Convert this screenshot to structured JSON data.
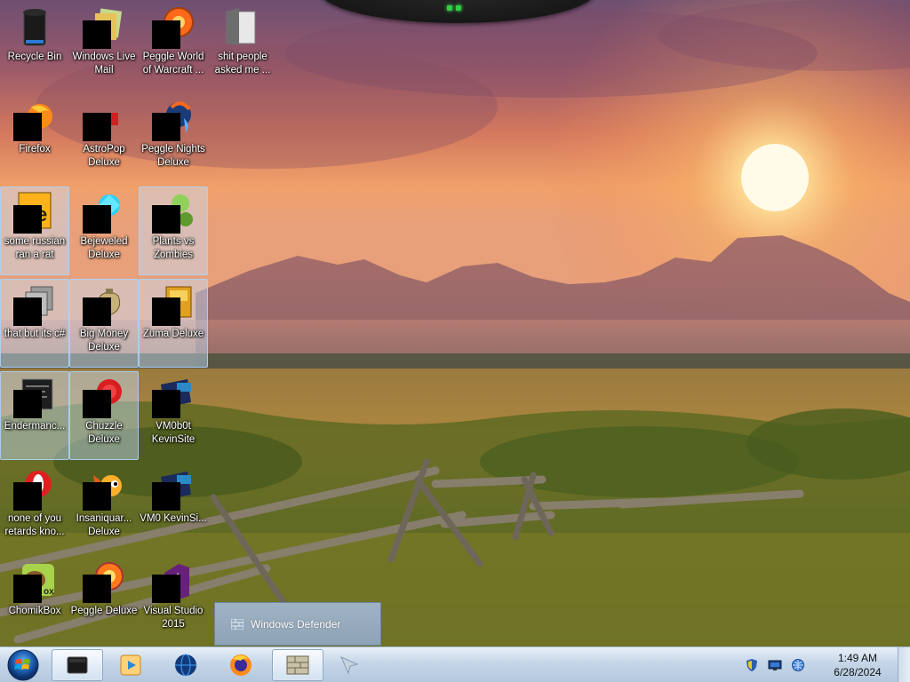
{
  "desktop": {
    "icons": [
      {
        "label": "Recycle Bin",
        "icon": "recycle-bin-icon",
        "redacted": false,
        "selected": false
      },
      {
        "label": "Windows Live Mail",
        "icon": "windows-live-mail-icon",
        "redacted": true,
        "selected": false
      },
      {
        "label": "Peggle World of Warcraft ...",
        "icon": "peggle-wow-icon",
        "redacted": true,
        "selected": false
      },
      {
        "label": "shit people asked me ...",
        "icon": "folder-icon",
        "redacted": false,
        "selected": false
      },
      {
        "label": "Firefox",
        "icon": "firefox-icon",
        "redacted": true,
        "selected": false
      },
      {
        "label": "AstroPop Deluxe",
        "icon": "astropop-icon",
        "redacted": true,
        "selected": false
      },
      {
        "label": "Peggle Nights Deluxe",
        "icon": "peggle-nights-icon",
        "redacted": true,
        "selected": false
      },
      {
        "label": "some russian ran a rat",
        "icon": "java-archive-icon",
        "redacted": true,
        "selected": true
      },
      {
        "label": "Bejeweled Deluxe",
        "icon": "bejeweled-icon",
        "redacted": true,
        "selected": false
      },
      {
        "label": "Plants vs Zombies",
        "icon": "plants-vs-zombies-icon",
        "redacted": true,
        "selected": true
      },
      {
        "label": "that but its c#",
        "icon": "copy-files-icon",
        "redacted": true,
        "selected": true
      },
      {
        "label": "Big Money Deluxe",
        "icon": "money-bag-icon",
        "redacted": true,
        "selected": true
      },
      {
        "label": "Zuma Deluxe",
        "icon": "zuma-icon",
        "redacted": true,
        "selected": true
      },
      {
        "label": "Endermanc...",
        "icon": "console-window-icon",
        "redacted": true,
        "selected": true
      },
      {
        "label": "Chuzzle Deluxe",
        "icon": "chuzzle-icon",
        "redacted": true,
        "selected": true
      },
      {
        "label": "VM0b0t KevinSite",
        "icon": "vm-shortcut-icon",
        "redacted": true,
        "selected": false
      },
      {
        "label": "none of you retards kno...",
        "icon": "opera-icon",
        "redacted": true,
        "selected": false
      },
      {
        "label": "Insaniquar... Deluxe",
        "icon": "insaniquarium-icon",
        "redacted": true,
        "selected": false
      },
      {
        "label": "VM0 KevinSi...",
        "icon": "vm-shortcut-icon",
        "redacted": true,
        "selected": false
      },
      {
        "label": "ChomikBox",
        "icon": "chomikbox-icon",
        "redacted": true,
        "selected": false
      },
      {
        "label": "Peggle Deluxe",
        "icon": "peggle-icon",
        "redacted": true,
        "selected": false
      },
      {
        "label": "Visual Studio 2015",
        "icon": "visual-studio-icon",
        "redacted": true,
        "selected": false
      }
    ]
  },
  "popup": {
    "label": "Windows Defender",
    "icon": "windows-defender-icon"
  },
  "taskbar": {
    "start_icon": "windows-start-orb-icon",
    "pinned": [
      {
        "name": "taskbar-app-black-box",
        "icon": "black-box-icon",
        "active": true
      },
      {
        "name": "taskbar-windows-media-player",
        "icon": "media-player-icon",
        "active": false
      },
      {
        "name": "taskbar-globe",
        "icon": "globe-icon",
        "active": false
      },
      {
        "name": "taskbar-firefox",
        "icon": "firefox-icon",
        "active": false
      },
      {
        "name": "taskbar-windows-defender",
        "icon": "brick-wall-icon",
        "active": true
      },
      {
        "name": "taskbar-cursor-app",
        "icon": "cursor-icon",
        "active": false
      }
    ],
    "tray_icons": [
      "security-shield-icon",
      "display-icon",
      "network-icon"
    ],
    "clock": {
      "time": "1:49 AM",
      "date": "6/28/2024"
    }
  },
  "colors": {
    "sky_top": "#6a4a6a",
    "sun": "#fff3c8",
    "taskbar": "#c5d6e8",
    "selection": "#c8e1fa"
  }
}
